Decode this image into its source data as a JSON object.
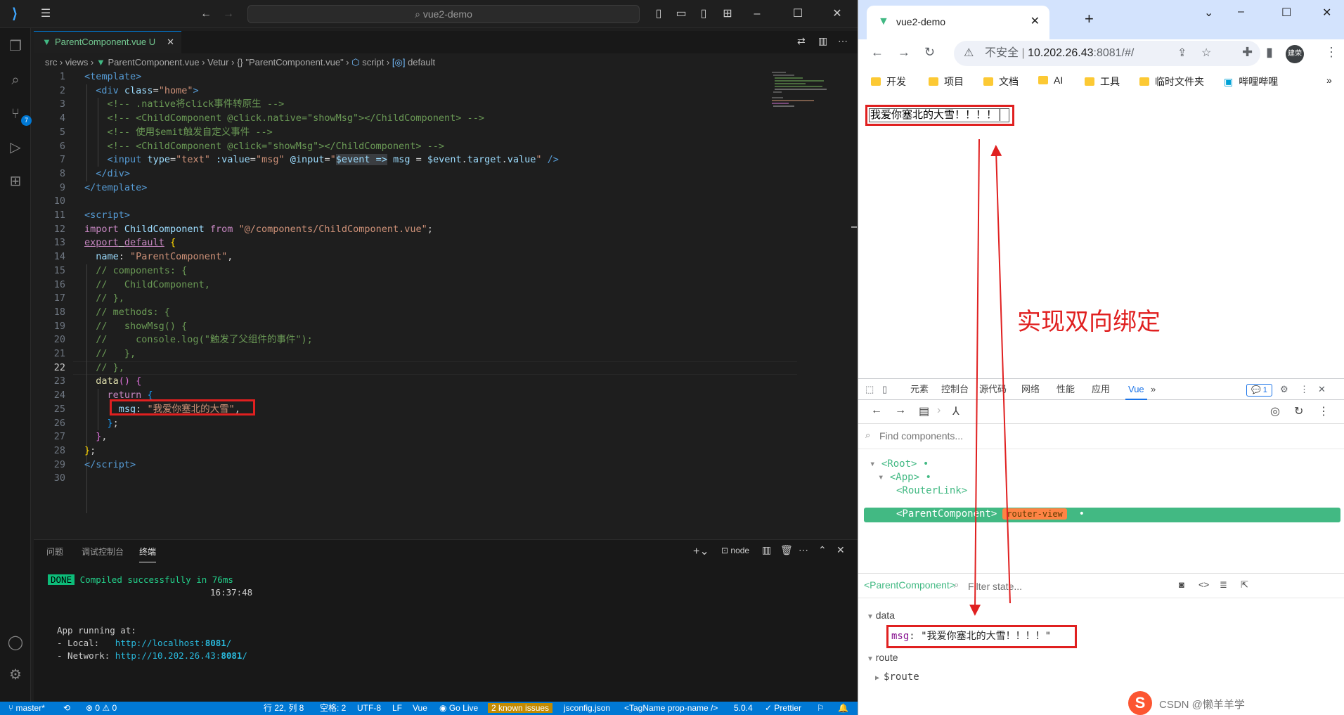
{
  "vscode": {
    "title": "vue2-demo",
    "tab": {
      "label": "ParentComponent.vue",
      "status": "U"
    },
    "breadcrumb": [
      "src",
      "views",
      "ParentComponent.vue",
      "Vetur",
      "\"ParentComponent.vue\"",
      "script",
      "default"
    ],
    "scm_badge": "7",
    "current_line": "22",
    "code_lines": [
      {
        "n": "1",
        "h": "<span class='tag'>&lt;template&gt;</span>"
      },
      {
        "n": "2",
        "h": "  <span class='tag'>&lt;div</span> <span class='attr'>class</span>=<span class='str'>\"home\"</span><span class='tag'>&gt;</span>"
      },
      {
        "n": "3",
        "h": "    <span class='cmt'>&lt;!-- .native将click事件转原生 --&gt;</span>"
      },
      {
        "n": "4",
        "h": "    <span class='cmt'>&lt;!-- &lt;ChildComponent @click.native=\"showMsg\"&gt;&lt;/ChildComponent&gt; --&gt;</span>"
      },
      {
        "n": "5",
        "h": "    <span class='cmt'>&lt;!-- 使用$emit触发自定义事件 --&gt;</span>"
      },
      {
        "n": "6",
        "h": "    <span class='cmt'>&lt;!-- &lt;ChildComponent @click=\"showMsg\"&gt;&lt;/ChildComponent&gt; --&gt;</span>"
      },
      {
        "n": "7",
        "h": "    <span class='tag'>&lt;input</span> <span class='attr'>type</span>=<span class='str'>\"text\"</span> <span class='attr'>:value</span>=<span class='str'>\"msg\"</span> <span class='attr'>@input</span>=<span class='str'>\"</span><span class='var' style='background:#3a3d41'>$event =&gt;</span> <span class='var'>msg</span> = <span class='var'>$event</span>.<span class='var'>target</span>.<span class='var'>value</span><span class='str'>\"</span> <span class='tag'>/&gt;</span>"
      },
      {
        "n": "8",
        "h": "  <span class='tag'>&lt;/div&gt;</span>"
      },
      {
        "n": "9",
        "h": "<span class='tag'>&lt;/template&gt;</span>"
      },
      {
        "n": "10",
        "h": ""
      },
      {
        "n": "11",
        "h": "<span class='tag'>&lt;script&gt;</span>"
      },
      {
        "n": "12",
        "h": "<span class='kw'>import</span> <span class='var'>ChildComponent</span> <span class='kw'>from</span> <span class='str'>\"@/components/ChildComponent.vue\"</span>;"
      },
      {
        "n": "13",
        "h": "<span class='kw' style='text-decoration:underline'>export</span><span style='text-decoration:underline'> </span><span class='kw' style='text-decoration:underline'>default</span> <span class='br1'>{</span>"
      },
      {
        "n": "14",
        "h": "  <span class='var'>name</span>: <span class='str'>\"ParentComponent\"</span>,"
      },
      {
        "n": "15",
        "h": "  <span class='cmt'>// components: {</span>"
      },
      {
        "n": "16",
        "h": "  <span class='cmt'>//   ChildComponent,</span>"
      },
      {
        "n": "17",
        "h": "  <span class='cmt'>// },</span>"
      },
      {
        "n": "18",
        "h": "  <span class='cmt'>// methods: {</span>"
      },
      {
        "n": "19",
        "h": "  <span class='cmt'>//   showMsg() {</span>"
      },
      {
        "n": "20",
        "h": "  <span class='cmt'>//     console.log(\"触发了父组件的事件\");</span>"
      },
      {
        "n": "21",
        "h": "  <span class='cmt'>//   },</span>"
      },
      {
        "n": "22",
        "h": "  <span class='cmt'>// },</span>"
      },
      {
        "n": "23",
        "h": "  <span class='fn'>data</span><span class='br2'>()</span> <span class='br2'>{</span>"
      },
      {
        "n": "24",
        "h": "    <span class='kw'>return</span> <span class='br3'>{</span>"
      },
      {
        "n": "25",
        "h": "      <span class='var'>msg</span>: <span class='str'>\"我爱你塞北的大雪\"</span>,"
      },
      {
        "n": "26",
        "h": "    <span class='br3'>}</span>;"
      },
      {
        "n": "27",
        "h": "  <span class='br2'>}</span>,"
      },
      {
        "n": "28",
        "h": "<span class='br1'>}</span>;"
      },
      {
        "n": "29",
        "h": "<span class='tag'>&lt;/script&gt;</span>"
      },
      {
        "n": "30",
        "h": ""
      }
    ],
    "panel": {
      "tabs": [
        "问题",
        "调试控制台",
        "终端"
      ],
      "shell": "node",
      "done_badge": "DONE",
      "compiled": "Compiled successfully in 76ms",
      "time": "16:37:48",
      "running": "App running at:",
      "local_label": "- Local:   ",
      "local_url_a": "http://localhost:",
      "local_port": "8081",
      "network_label": "- Network: ",
      "network_url_a": "http://10.202.26.43:",
      "network_port": "8081"
    },
    "status": {
      "branch": "master*",
      "errors": "⊗ 0 ⚠ 0",
      "position": "行 22, 列 8",
      "spaces": "空格: 2",
      "encoding": "UTF-8",
      "eol": "LF",
      "lang": "Vue",
      "golive": "Go Live",
      "issues": "2 known issues",
      "jsconfig": "jsconfig.json",
      "tagname": "<TagName prop-name />",
      "version": "5.0.4",
      "prettier": "✓ Prettier"
    }
  },
  "browser": {
    "tab_title": "vue2-demo",
    "security": "不安全",
    "url_host": "10.202.26.43",
    "url_rest": ":8081/#/",
    "profile": "建荣",
    "bookmarks": [
      "开发",
      "项目",
      "文档",
      "AI",
      "工具",
      "临时文件夹",
      "哔哩哔哩"
    ],
    "input_value": "我爱你塞北的大雪！！！！",
    "annotation": "实现双向绑定",
    "devtools": {
      "tabs": [
        "元素",
        "控制台",
        "源代码",
        "网络",
        "性能",
        "应用",
        "Vue"
      ],
      "message_count": "1",
      "find_placeholder": "Find components...",
      "tree": [
        "<Root>",
        "<App>",
        "<RouterLink>",
        "<ParentComponent>"
      ],
      "router_view": "router-view",
      "selected": "<ParentComponent>",
      "filter_placeholder": "Filter state...",
      "data_section": "data",
      "msg_key": "msg",
      "msg_value": "\"我爱你塞北的大雪！！！！\"",
      "route_section": "route",
      "route_key": "$route"
    },
    "watermark": "CSDN @懒羊羊学"
  },
  "colors": {
    "accent": "#0078d4",
    "vue_green": "#42b983",
    "annotation_red": "#e02020"
  }
}
